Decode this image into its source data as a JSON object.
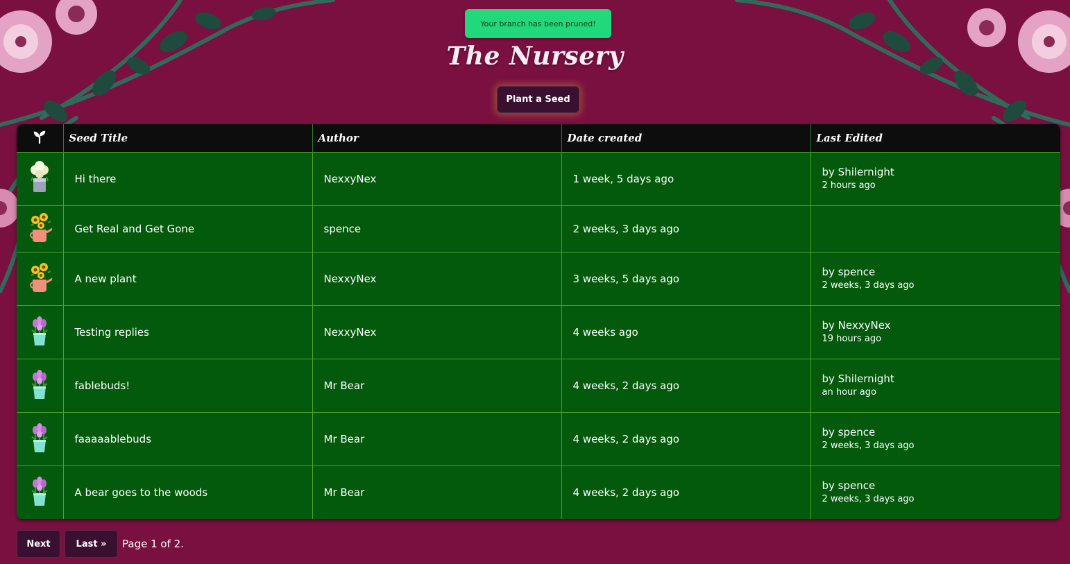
{
  "toast": {
    "message": "Your branch has been pruned!"
  },
  "header": {
    "title": "The Nursery",
    "plant_button": "Plant a Seed"
  },
  "table": {
    "icon_header": "sprout-icon",
    "columns": [
      "Seed Title",
      "Author",
      "Date created",
      "Last Edited"
    ],
    "rows": [
      {
        "icon": "white-flower-bucket-icon",
        "title": "Hi there",
        "author": "NexxyNex",
        "created": "1 week, 5 days ago",
        "edited_by": "by Shilernight",
        "edited_ago": "2 hours ago"
      },
      {
        "icon": "sunflower-watering-can-icon",
        "title": "Get Real and Get Gone",
        "author": "spence",
        "created": "2 weeks, 3 days ago",
        "edited_by": "",
        "edited_ago": ""
      },
      {
        "icon": "sunflower-watering-can-icon",
        "title": "A new plant",
        "author": "NexxyNex",
        "created": "3 weeks, 5 days ago",
        "edited_by": "by spence",
        "edited_ago": "2 weeks, 3 days ago"
      },
      {
        "icon": "tulip-bucket-icon",
        "title": "Testing replies",
        "author": "NexxyNex",
        "created": "4 weeks ago",
        "edited_by": "by NexxyNex",
        "edited_ago": "19 hours ago"
      },
      {
        "icon": "tulip-bucket-icon",
        "title": "fablebuds!",
        "author": "Mr Bear",
        "created": "4 weeks, 2 days ago",
        "edited_by": "by Shilernight",
        "edited_ago": "an hour ago"
      },
      {
        "icon": "tulip-bucket-icon",
        "title": "faaaaablebuds",
        "author": "Mr Bear",
        "created": "4 weeks, 2 days ago",
        "edited_by": "by spence",
        "edited_ago": "2 weeks, 3 days ago"
      },
      {
        "icon": "tulip-bucket-icon",
        "title": "A bear goes to the woods",
        "author": "Mr Bear",
        "created": "4 weeks, 2 days ago",
        "edited_by": "by spence",
        "edited_ago": "2 weeks, 3 days ago"
      }
    ]
  },
  "pager": {
    "next": "Next",
    "last": "Last »",
    "status": "Page 1 of 2."
  },
  "colors": {
    "background": "#7a1040",
    "row": "#045a0c",
    "header": "#0d0d0d",
    "toast": "#21d97a",
    "button": "#3a1030"
  }
}
